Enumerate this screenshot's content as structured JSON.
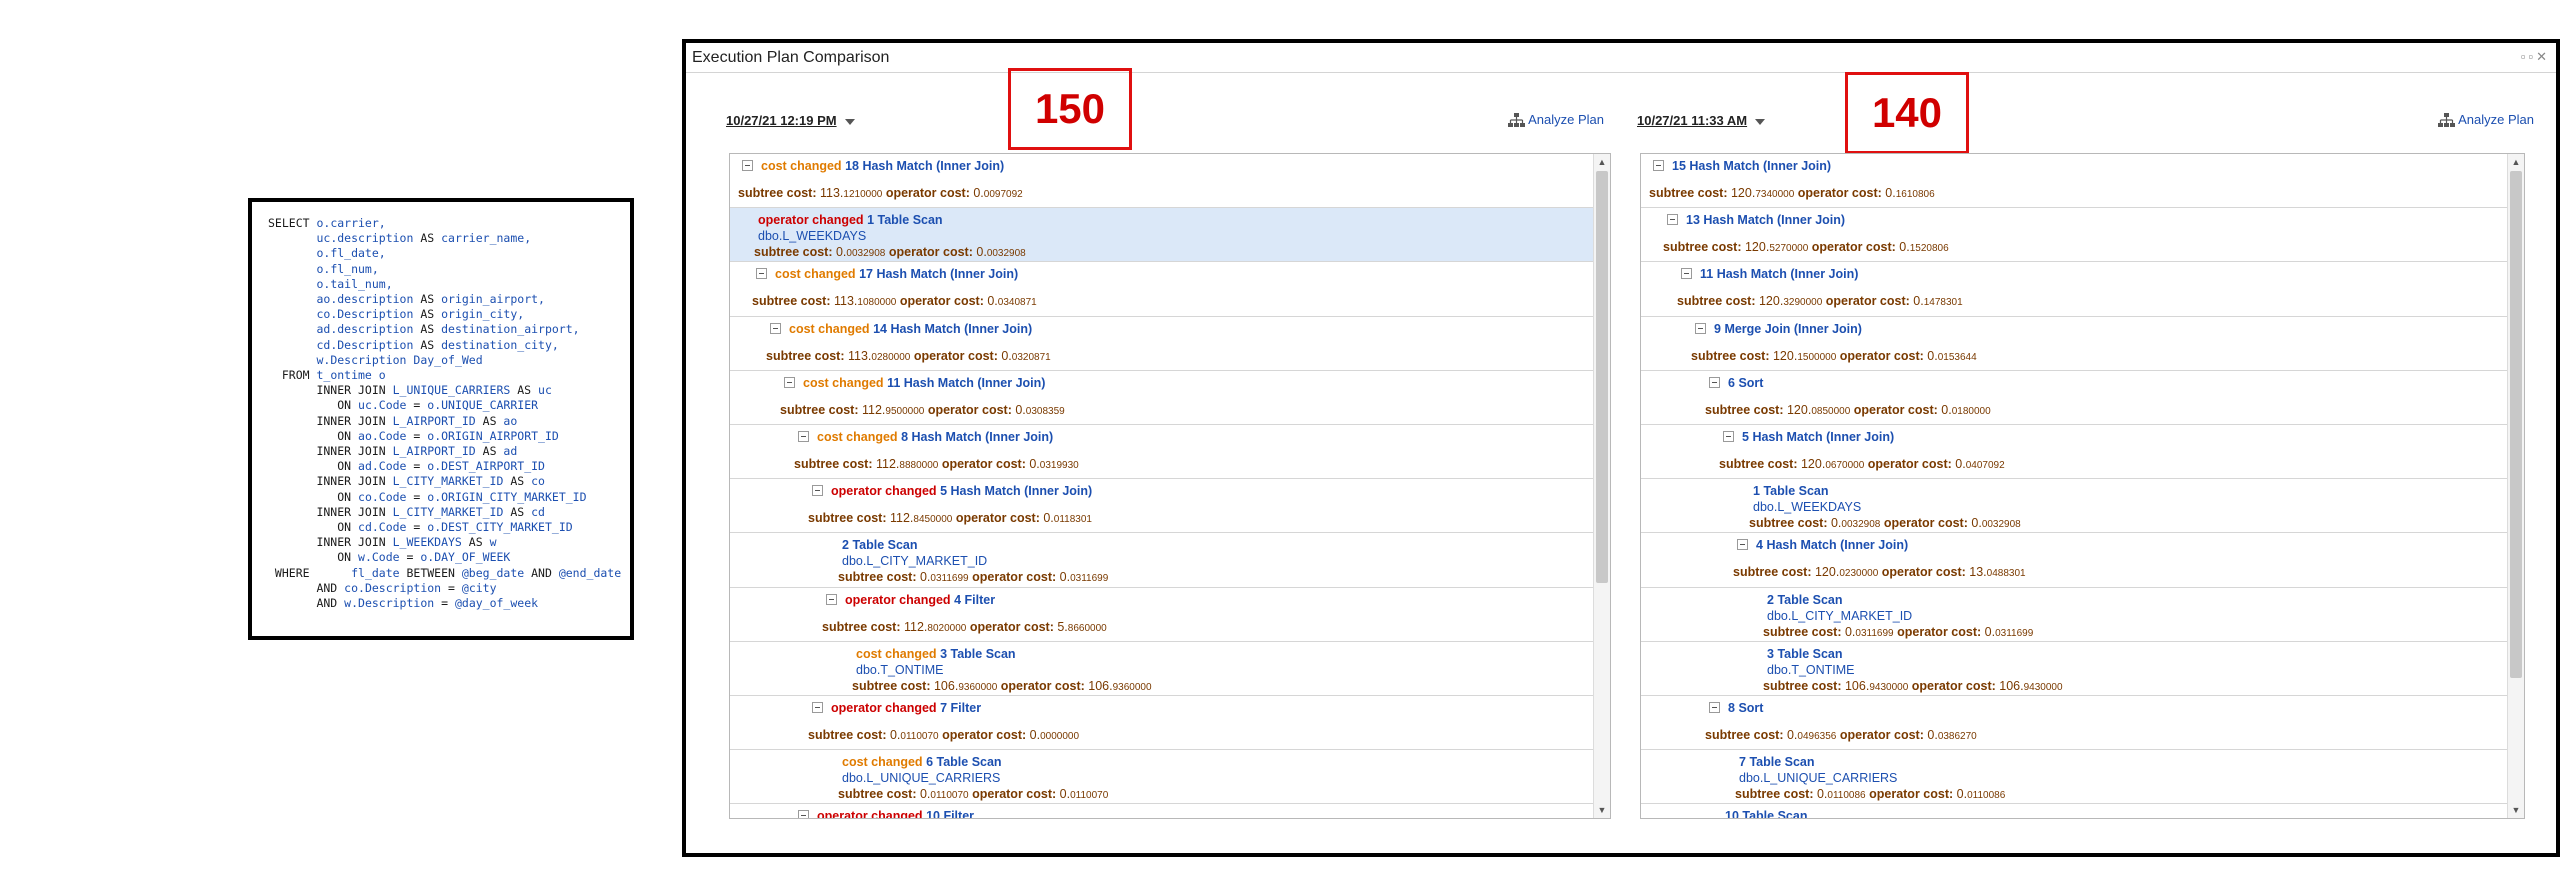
{
  "sql": [
    [
      {
        "t": "SELECT ",
        "c": "kw"
      },
      {
        "t": "o.carrier,",
        "c": "id"
      }
    ],
    [
      {
        "t": "       ",
        "c": "kw"
      },
      {
        "t": "uc.description ",
        "c": "id"
      },
      {
        "t": "AS ",
        "c": "kw"
      },
      {
        "t": "carrier_name,",
        "c": "id"
      }
    ],
    [
      {
        "t": "       ",
        "c": "kw"
      },
      {
        "t": "o.fl_date,",
        "c": "id"
      }
    ],
    [
      {
        "t": "       ",
        "c": "kw"
      },
      {
        "t": "o.fl_num,",
        "c": "id"
      }
    ],
    [
      {
        "t": "       ",
        "c": "kw"
      },
      {
        "t": "o.tail_num,",
        "c": "id"
      }
    ],
    [
      {
        "t": "       ",
        "c": "kw"
      },
      {
        "t": "ao.description ",
        "c": "id"
      },
      {
        "t": "AS ",
        "c": "kw"
      },
      {
        "t": "origin_airport,",
        "c": "id"
      }
    ],
    [
      {
        "t": "       ",
        "c": "kw"
      },
      {
        "t": "co.Description ",
        "c": "id"
      },
      {
        "t": "AS ",
        "c": "kw"
      },
      {
        "t": "origin_city,",
        "c": "id"
      }
    ],
    [
      {
        "t": "       ",
        "c": "kw"
      },
      {
        "t": "ad.description ",
        "c": "id"
      },
      {
        "t": "AS ",
        "c": "kw"
      },
      {
        "t": "destination_airport,",
        "c": "id"
      }
    ],
    [
      {
        "t": "       ",
        "c": "kw"
      },
      {
        "t": "cd.Description ",
        "c": "id"
      },
      {
        "t": "AS ",
        "c": "kw"
      },
      {
        "t": "destination_city,",
        "c": "id"
      }
    ],
    [
      {
        "t": "       ",
        "c": "kw"
      },
      {
        "t": "w.Description Day_of_Wed",
        "c": "id"
      }
    ],
    [
      {
        "t": "  FROM ",
        "c": "kw"
      },
      {
        "t": "t_ontime o",
        "c": "id"
      }
    ],
    [
      {
        "t": "       INNER JOIN ",
        "c": "kw"
      },
      {
        "t": "L_UNIQUE_CARRIERS ",
        "c": "id"
      },
      {
        "t": "AS ",
        "c": "kw"
      },
      {
        "t": "uc",
        "c": "id"
      }
    ],
    [
      {
        "t": "          ON ",
        "c": "kw"
      },
      {
        "t": "uc.Code ",
        "c": "id"
      },
      {
        "t": "= ",
        "c": "kw"
      },
      {
        "t": "o.UNIQUE_CARRIER",
        "c": "id"
      }
    ],
    [
      {
        "t": "       INNER JOIN ",
        "c": "kw"
      },
      {
        "t": "L_AIRPORT_ID ",
        "c": "id"
      },
      {
        "t": "AS ",
        "c": "kw"
      },
      {
        "t": "ao",
        "c": "id"
      }
    ],
    [
      {
        "t": "          ON ",
        "c": "kw"
      },
      {
        "t": "ao.Code ",
        "c": "id"
      },
      {
        "t": "= ",
        "c": "kw"
      },
      {
        "t": "o.ORIGIN_AIRPORT_ID",
        "c": "id"
      }
    ],
    [
      {
        "t": "       INNER JOIN ",
        "c": "kw"
      },
      {
        "t": "L_AIRPORT_ID ",
        "c": "id"
      },
      {
        "t": "AS ",
        "c": "kw"
      },
      {
        "t": "ad",
        "c": "id"
      }
    ],
    [
      {
        "t": "          ON ",
        "c": "kw"
      },
      {
        "t": "ad.Code ",
        "c": "id"
      },
      {
        "t": "= ",
        "c": "kw"
      },
      {
        "t": "o.DEST_AIRPORT_ID",
        "c": "id"
      }
    ],
    [
      {
        "t": "       INNER JOIN ",
        "c": "kw"
      },
      {
        "t": "L_CITY_MARKET_ID ",
        "c": "id"
      },
      {
        "t": "AS ",
        "c": "kw"
      },
      {
        "t": "co",
        "c": "id"
      }
    ],
    [
      {
        "t": "          ON ",
        "c": "kw"
      },
      {
        "t": "co.Code ",
        "c": "id"
      },
      {
        "t": "= ",
        "c": "kw"
      },
      {
        "t": "o.ORIGIN_CITY_MARKET_ID",
        "c": "id"
      }
    ],
    [
      {
        "t": "       INNER JOIN ",
        "c": "kw"
      },
      {
        "t": "L_CITY_MARKET_ID ",
        "c": "id"
      },
      {
        "t": "AS ",
        "c": "kw"
      },
      {
        "t": "cd",
        "c": "id"
      }
    ],
    [
      {
        "t": "          ON ",
        "c": "kw"
      },
      {
        "t": "cd.Code ",
        "c": "id"
      },
      {
        "t": "= ",
        "c": "kw"
      },
      {
        "t": "o.DEST_CITY_MARKET_ID",
        "c": "id"
      }
    ],
    [
      {
        "t": "       INNER JOIN ",
        "c": "kw"
      },
      {
        "t": "L_WEEKDAYS ",
        "c": "id"
      },
      {
        "t": "AS ",
        "c": "kw"
      },
      {
        "t": "w",
        "c": "id"
      }
    ],
    [
      {
        "t": "          ON ",
        "c": "kw"
      },
      {
        "t": "w.Code ",
        "c": "id"
      },
      {
        "t": "= ",
        "c": "kw"
      },
      {
        "t": "o.DAY_OF_WEEK",
        "c": "id"
      }
    ],
    [
      {
        "t": " WHERE      ",
        "c": "kw"
      },
      {
        "t": "fl_date ",
        "c": "id"
      },
      {
        "t": "BETWEEN ",
        "c": "kw"
      },
      {
        "t": "@beg_date ",
        "c": "vr"
      },
      {
        "t": "AND ",
        "c": "kw"
      },
      {
        "t": "@end_date",
        "c": "vr"
      }
    ],
    [
      {
        "t": "       AND ",
        "c": "kw"
      },
      {
        "t": "co.Description ",
        "c": "id"
      },
      {
        "t": "= ",
        "c": "kw"
      },
      {
        "t": "@city",
        "c": "vr"
      }
    ],
    [
      {
        "t": "       AND ",
        "c": "kw"
      },
      {
        "t": "w.Description ",
        "c": "id"
      },
      {
        "t": "= ",
        "c": "kw"
      },
      {
        "t": "@day_of_week",
        "c": "vr"
      }
    ]
  ],
  "window": {
    "title": "Execution Plan Comparison",
    "controls": "▫▫✕"
  },
  "labels": {
    "subtree": "subtree cost:",
    "operator": "operator cost:",
    "cost_changed": "cost changed",
    "operator_changed": "operator changed",
    "analyze": "Analyze Plan"
  },
  "left": {
    "date": "10/27/21 12:19 PM",
    "annotation": "150",
    "scroll_fraction": 0.65,
    "rows": [
      {
        "indent": 0,
        "tog": true,
        "change": "cost",
        "num": "18",
        "op": "Hash Match (Inner Join)",
        "sub": "",
        "st_main": "113.",
        "st_dec": "1210000",
        "oc_main": "0.",
        "oc_dec": "0097092",
        "sel": false
      },
      {
        "indent": 0,
        "tog": false,
        "change": "op",
        "num": "1",
        "op": "Table Scan",
        "sub": "dbo.L_WEEKDAYS",
        "st_main": "0.",
        "st_dec": "0032908",
        "oc_main": "0.",
        "oc_dec": "0032908",
        "sel": true
      },
      {
        "indent": 1,
        "tog": true,
        "change": "cost",
        "num": "17",
        "op": "Hash Match (Inner Join)",
        "sub": "",
        "st_main": "113.",
        "st_dec": "1080000",
        "oc_main": "0.",
        "oc_dec": "0340871",
        "sel": false
      },
      {
        "indent": 2,
        "tog": true,
        "change": "cost",
        "num": "14",
        "op": "Hash Match (Inner Join)",
        "sub": "",
        "st_main": "113.",
        "st_dec": "0280000",
        "oc_main": "0.",
        "oc_dec": "0320871",
        "sel": false
      },
      {
        "indent": 3,
        "tog": true,
        "change": "cost",
        "num": "11",
        "op": "Hash Match (Inner Join)",
        "sub": "",
        "st_main": "112.",
        "st_dec": "9500000",
        "oc_main": "0.",
        "oc_dec": "0308359",
        "sel": false
      },
      {
        "indent": 4,
        "tog": true,
        "change": "cost",
        "num": "8",
        "op": "Hash Match (Inner Join)",
        "sub": "",
        "st_main": "112.",
        "st_dec": "8880000",
        "oc_main": "0.",
        "oc_dec": "0319930",
        "sel": false
      },
      {
        "indent": 5,
        "tog": true,
        "change": "op",
        "num": "5",
        "op": "Hash Match (Inner Join)",
        "sub": "",
        "st_main": "112.",
        "st_dec": "8450000",
        "oc_main": "0.",
        "oc_dec": "0118301",
        "sel": false
      },
      {
        "indent": 6,
        "tog": false,
        "change": "",
        "num": "2",
        "op": "Table Scan",
        "sub": "dbo.L_CITY_MARKET_ID",
        "st_main": "0.",
        "st_dec": "0311699",
        "oc_main": "0.",
        "oc_dec": "0311699",
        "sel": false
      },
      {
        "indent": 6,
        "tog": true,
        "change": "op",
        "num": "4",
        "op": "Filter",
        "sub": "",
        "st_main": "112.",
        "st_dec": "8020000",
        "oc_main": "5.",
        "oc_dec": "8660000",
        "sel": false
      },
      {
        "indent": 7,
        "tog": false,
        "change": "cost",
        "num": "3",
        "op": "Table Scan",
        "sub": "dbo.T_ONTIME",
        "st_main": "106.",
        "st_dec": "9360000",
        "oc_main": "106.",
        "oc_dec": "9360000",
        "sel": false
      },
      {
        "indent": 5,
        "tog": true,
        "change": "op",
        "num": "7",
        "op": "Filter",
        "sub": "",
        "st_main": "0.",
        "st_dec": "0110070",
        "oc_main": "0.",
        "oc_dec": "0000000",
        "sel": false
      },
      {
        "indent": 6,
        "tog": false,
        "change": "cost",
        "num": "6",
        "op": "Table Scan",
        "sub": "dbo.L_UNIQUE_CARRIERS",
        "st_main": "0.",
        "st_dec": "0110070",
        "oc_main": "0.",
        "oc_dec": "0110070",
        "sel": false
      },
      {
        "indent": 4,
        "tog": true,
        "change": "op",
        "num": "10",
        "op": "Filter",
        "sub": "",
        "st_main": "",
        "st_dec": "",
        "oc_main": "",
        "oc_dec": "",
        "sel": false
      }
    ]
  },
  "right": {
    "date": "10/27/21 11:33 AM",
    "annotation": "140",
    "scroll_fraction": 0.8,
    "rows": [
      {
        "indent": 0,
        "tog": true,
        "change": "",
        "num": "15",
        "op": "Hash Match (Inner Join)",
        "sub": "",
        "st_main": "120.",
        "st_dec": "7340000",
        "oc_main": "0.",
        "oc_dec": "1610806",
        "sel": false
      },
      {
        "indent": 1,
        "tog": true,
        "change": "",
        "num": "13",
        "op": "Hash Match (Inner Join)",
        "sub": "",
        "st_main": "120.",
        "st_dec": "5270000",
        "oc_main": "0.",
        "oc_dec": "1520806",
        "sel": false
      },
      {
        "indent": 2,
        "tog": true,
        "change": "",
        "num": "11",
        "op": "Hash Match (Inner Join)",
        "sub": "",
        "st_main": "120.",
        "st_dec": "3290000",
        "oc_main": "0.",
        "oc_dec": "1478301",
        "sel": false
      },
      {
        "indent": 3,
        "tog": true,
        "change": "",
        "num": "9",
        "op": "Merge Join (Inner Join)",
        "sub": "",
        "st_main": "120.",
        "st_dec": "1500000",
        "oc_main": "0.",
        "oc_dec": "0153644",
        "sel": false
      },
      {
        "indent": 4,
        "tog": true,
        "change": "",
        "num": "6",
        "op": "Sort",
        "sub": "",
        "st_main": "120.",
        "st_dec": "0850000",
        "oc_main": "0.",
        "oc_dec": "0180000",
        "sel": false
      },
      {
        "indent": 5,
        "tog": true,
        "change": "",
        "num": "5",
        "op": "Hash Match (Inner Join)",
        "sub": "",
        "st_main": "120.",
        "st_dec": "0670000",
        "oc_main": "0.",
        "oc_dec": "0407092",
        "sel": false
      },
      {
        "indent": 6,
        "tog": false,
        "change": "",
        "num": "1",
        "op": "Table Scan",
        "sub": "dbo.L_WEEKDAYS",
        "st_main": "0.",
        "st_dec": "0032908",
        "oc_main": "0.",
        "oc_dec": "0032908",
        "sel": false
      },
      {
        "indent": 6,
        "tog": true,
        "change": "",
        "num": "4",
        "op": "Hash Match (Inner Join)",
        "sub": "",
        "st_main": "120.",
        "st_dec": "0230000",
        "oc_main": "13.",
        "oc_dec": "0488301",
        "sel": false
      },
      {
        "indent": 7,
        "tog": false,
        "change": "",
        "num": "2",
        "op": "Table Scan",
        "sub": "dbo.L_CITY_MARKET_ID",
        "st_main": "0.",
        "st_dec": "0311699",
        "oc_main": "0.",
        "oc_dec": "0311699",
        "sel": false
      },
      {
        "indent": 7,
        "tog": false,
        "change": "",
        "num": "3",
        "op": "Table Scan",
        "sub": "dbo.T_ONTIME",
        "st_main": "106.",
        "st_dec": "9430000",
        "oc_main": "106.",
        "oc_dec": "9430000",
        "sel": false
      },
      {
        "indent": 4,
        "tog": true,
        "change": "",
        "num": "8",
        "op": "Sort",
        "sub": "",
        "st_main": "0.",
        "st_dec": "0496356",
        "oc_main": "0.",
        "oc_dec": "0386270",
        "sel": false
      },
      {
        "indent": 5,
        "tog": false,
        "change": "",
        "num": "7",
        "op": "Table Scan",
        "sub": "dbo.L_UNIQUE_CARRIERS",
        "st_main": "0.",
        "st_dec": "0110086",
        "oc_main": "0.",
        "oc_dec": "0110086",
        "sel": false
      },
      {
        "indent": 4,
        "tog": false,
        "change": "",
        "num": "10",
        "op": "Table Scan",
        "sub": "",
        "st_main": "",
        "st_dec": "",
        "oc_main": "",
        "oc_dec": "",
        "sel": false
      }
    ]
  }
}
